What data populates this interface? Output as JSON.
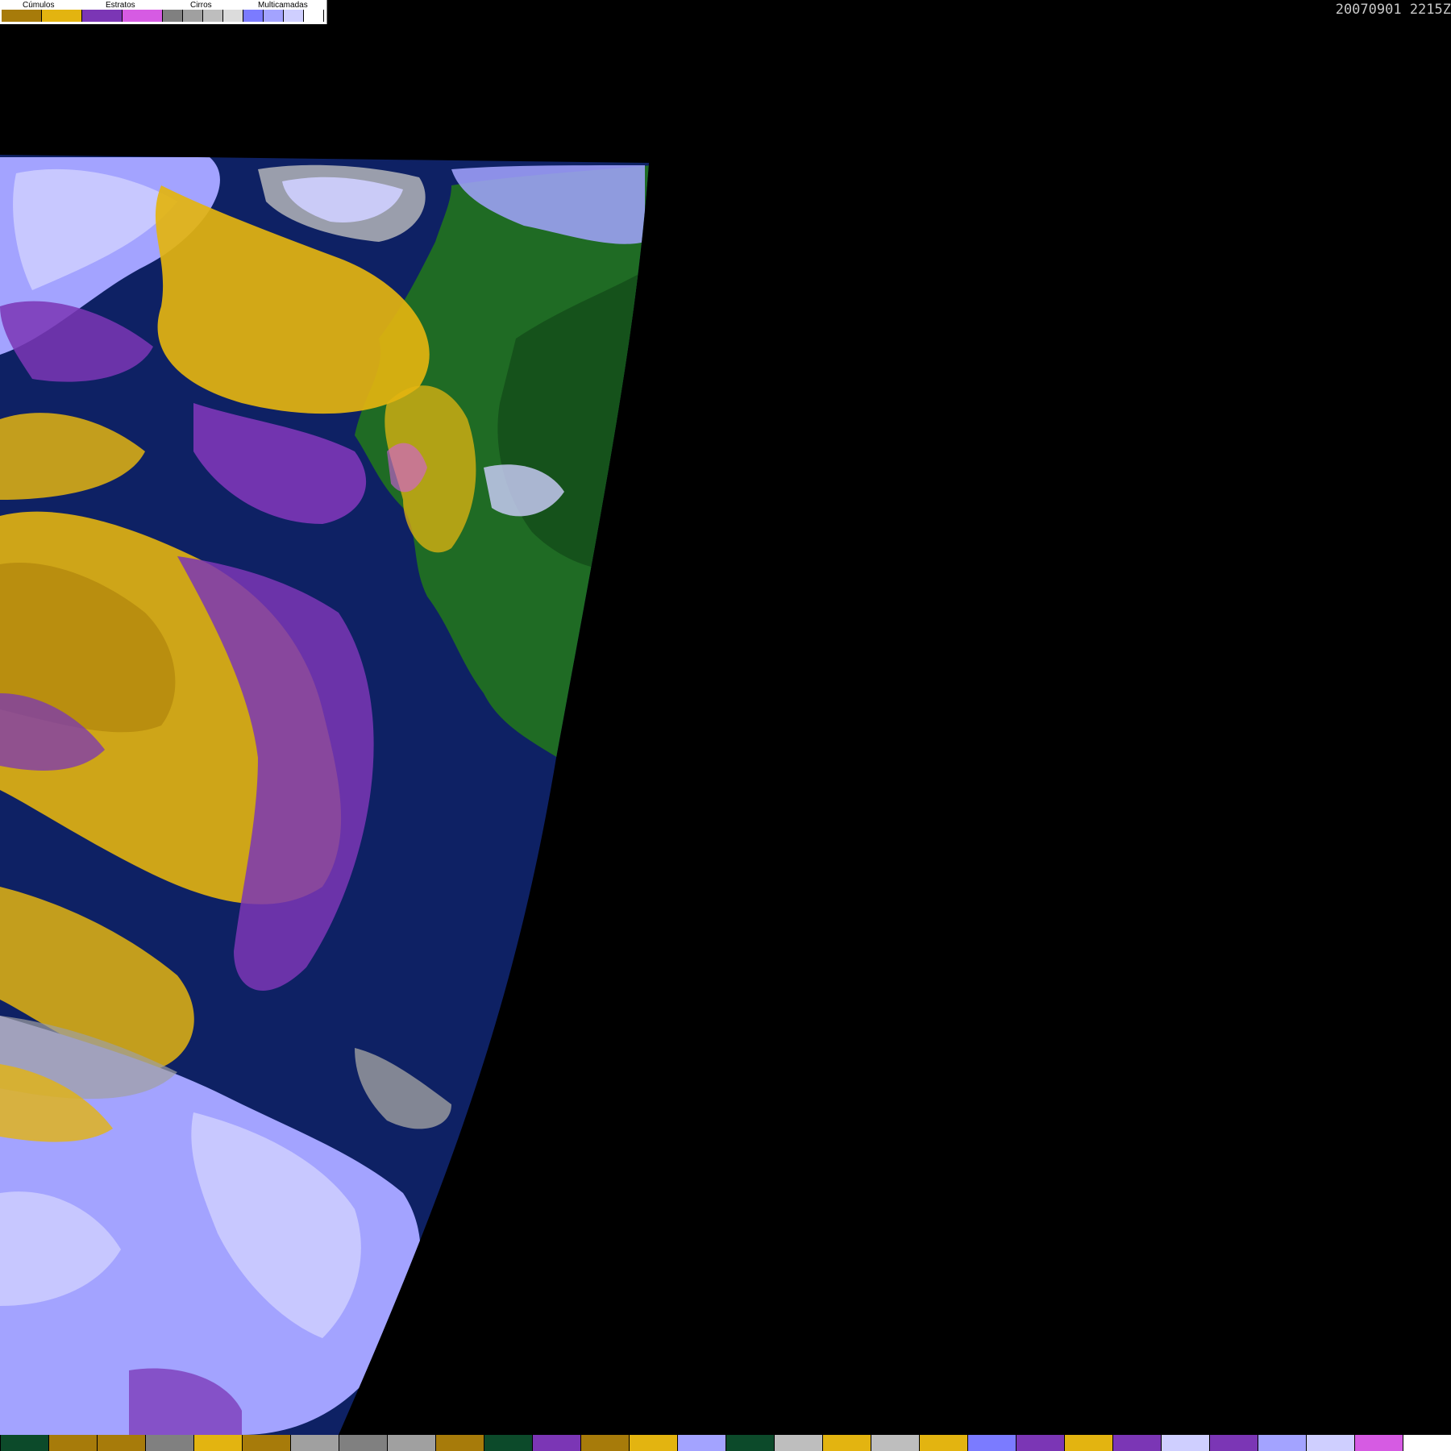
{
  "timestamp": "20070901 2215Z",
  "legend": {
    "groups": [
      {
        "label": "Cúmulos",
        "colors": [
          "#a77b0a",
          "#e3b410"
        ]
      },
      {
        "label": "Estratos",
        "colors": [
          "#7b36b5",
          "#d65be3"
        ]
      },
      {
        "label": "Cirros",
        "colors": [
          "#808080",
          "#a0a0a0",
          "#bebebe",
          "#dcdcdc"
        ]
      },
      {
        "label": "Multicamadas",
        "colors": [
          "#7b7bff",
          "#a3a3ff",
          "#cfcfff",
          "#ffffff"
        ]
      }
    ]
  },
  "map_colors": {
    "space": "#000000",
    "ocean": "#0e2164",
    "land": "#1f6b24",
    "land_dark": "#134a18",
    "cumulus": "#e3b410",
    "cumulus_dark": "#a77b0a",
    "stratus": "#7b36b5",
    "stratus_light": "#d65be3",
    "cirrus": "#a0a0a0",
    "cirrus_light": "#bebebe",
    "multilayer": "#a3a3ff",
    "multilayer_light": "#cfcfff"
  },
  "bottom_bar_colors": [
    "#0c4a2a",
    "#a77b0a",
    "#a77b0a",
    "#808080",
    "#e3b410",
    "#a77b0a",
    "#a0a0a0",
    "#808080",
    "#a0a0a0",
    "#a77b0a",
    "#0c4a2a",
    "#7b36b5",
    "#a77b0a",
    "#e3b410",
    "#a3a3ff",
    "#0c4a2a",
    "#bebebe",
    "#e3b410",
    "#bebebe",
    "#e3b410",
    "#7b7bff",
    "#7b36b5",
    "#e3b410",
    "#7b36b5",
    "#cfcfff",
    "#7b36b5",
    "#a3a3ff",
    "#cfcfff",
    "#d65be3",
    "#ffffff"
  ]
}
